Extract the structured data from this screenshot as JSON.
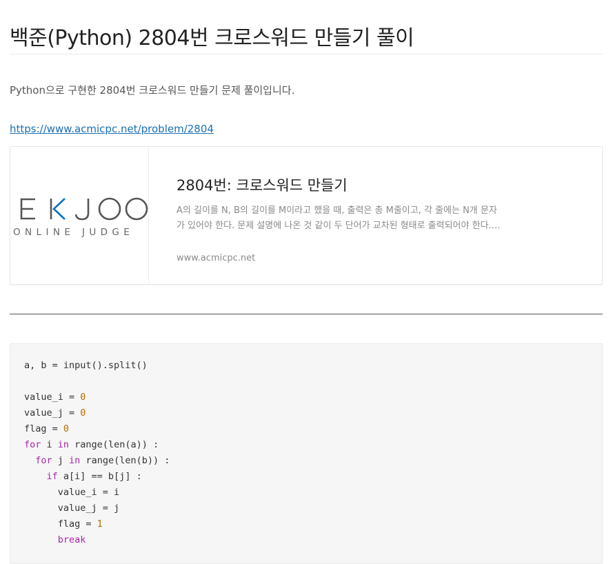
{
  "post": {
    "title": "백준(Python) 2804번 크로스워드 만들기 풀이",
    "intro": "Python으로 구현한 2804번 크로스워드 만들기 문제 풀이입니다.",
    "link": "https://www.acmicpc.net/problem/2804"
  },
  "og_card": {
    "logo": {
      "mark": "BAEKJOON",
      "sub": "ONLINE JUDGE",
      "accent_color": "#0076c0",
      "text_color": "#555555"
    },
    "title": "2804번: 크로스워드 만들기",
    "description": "A의 길이를 N, B의 길이를 M이라고 했을 때, 출력은 총 M줄이고, 각 줄에는 N개 문자가 있어야 한다. 문제 설명에 나온 것 같이 두 단어가 교차된 형태로 출력되어야 한다. 나머지 칸은 '.'로 채운다.",
    "domain": "www.acmicpc.net"
  },
  "code": {
    "language": "python",
    "lines": [
      [
        {
          "t": "a, b = input().split()"
        }
      ],
      [],
      [
        {
          "t": "value_i = "
        },
        {
          "t": "0",
          "k": "num"
        }
      ],
      [
        {
          "t": "value_j = "
        },
        {
          "t": "0",
          "k": "num"
        }
      ],
      [
        {
          "t": "flag = "
        },
        {
          "t": "0",
          "k": "num"
        }
      ],
      [
        {
          "t": "for",
          "k": "kw"
        },
        {
          "t": " i "
        },
        {
          "t": "in",
          "k": "kw"
        },
        {
          "t": " range(len(a)) :"
        }
      ],
      [
        {
          "t": "  "
        },
        {
          "t": "for",
          "k": "kw"
        },
        {
          "t": " j "
        },
        {
          "t": "in",
          "k": "kw"
        },
        {
          "t": " range(len(b)) :"
        }
      ],
      [
        {
          "t": "    "
        },
        {
          "t": "if",
          "k": "kw"
        },
        {
          "t": " a[i] == b[j] :"
        }
      ],
      [
        {
          "t": "      value_i = i"
        }
      ],
      [
        {
          "t": "      value_j = j"
        }
      ],
      [
        {
          "t": "      flag = "
        },
        {
          "t": "1",
          "k": "num"
        }
      ],
      [
        {
          "t": "      "
        },
        {
          "t": "break",
          "k": "kw"
        }
      ]
    ]
  }
}
